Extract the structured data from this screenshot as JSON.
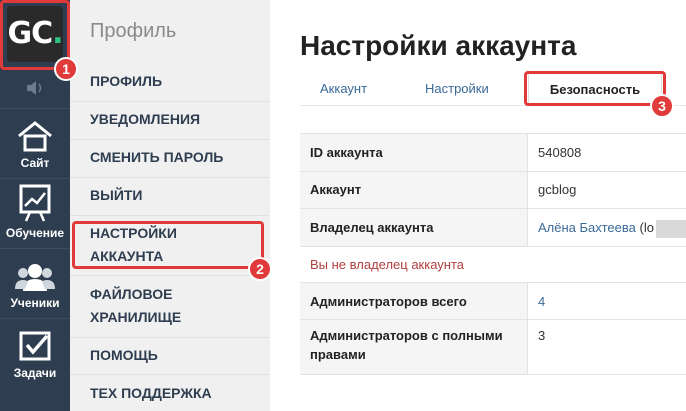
{
  "logo": {
    "text": "GC",
    "dot": "."
  },
  "rail": {
    "items": [
      {
        "label": "Сайт",
        "icon": "house-icon"
      },
      {
        "label": "Обучение",
        "icon": "chart-board-icon"
      },
      {
        "label": "Ученики",
        "icon": "users-icon"
      },
      {
        "label": "Задачи",
        "icon": "checkbox-icon"
      }
    ]
  },
  "submenu": {
    "title": "Профиль",
    "items": {
      "profile": "ПРОФИЛЬ",
      "notifications": "УВЕДОМЛЕНИЯ",
      "change_password": "СМЕНИТЬ ПАРОЛЬ",
      "logout": "ВЫЙТИ",
      "account_settings_1": "НАСТРОЙКИ",
      "account_settings_2": "АККАУНТА",
      "file_storage_1": "ФАЙЛОВОЕ",
      "file_storage_2": "ХРАНИЛИЩЕ",
      "help": "ПОМОЩЬ",
      "support": "ТЕХ ПОДДЕРЖКА"
    }
  },
  "main": {
    "title": "Настройки аккаунта",
    "tabs": {
      "account": "Аккаунт",
      "settings": "Настройки",
      "security": "Безопасность"
    },
    "rows": {
      "id_label": "ID аккаунта",
      "id_value": "540808",
      "account_label": "Аккаунт",
      "account_value": "gcblog",
      "owner_label": "Владелец аккаунта",
      "owner_value": "Алёна Бахтеева",
      "owner_suffix": "(lo",
      "not_owner": "Вы не владелец аккаунта",
      "admins_total_label": "Администраторов всего",
      "admins_total_value": "4",
      "admins_full_label_1": "Администраторов с полными",
      "admins_full_label_2": "правами",
      "admins_full_value": "3"
    }
  },
  "annotations": {
    "badge1": "1",
    "badge2": "2",
    "badge3": "3"
  },
  "colors": {
    "rail": "#2e3e50",
    "accent": "#e03a3a",
    "link": "#3b6a99",
    "logo_dot": "#2fc285"
  }
}
